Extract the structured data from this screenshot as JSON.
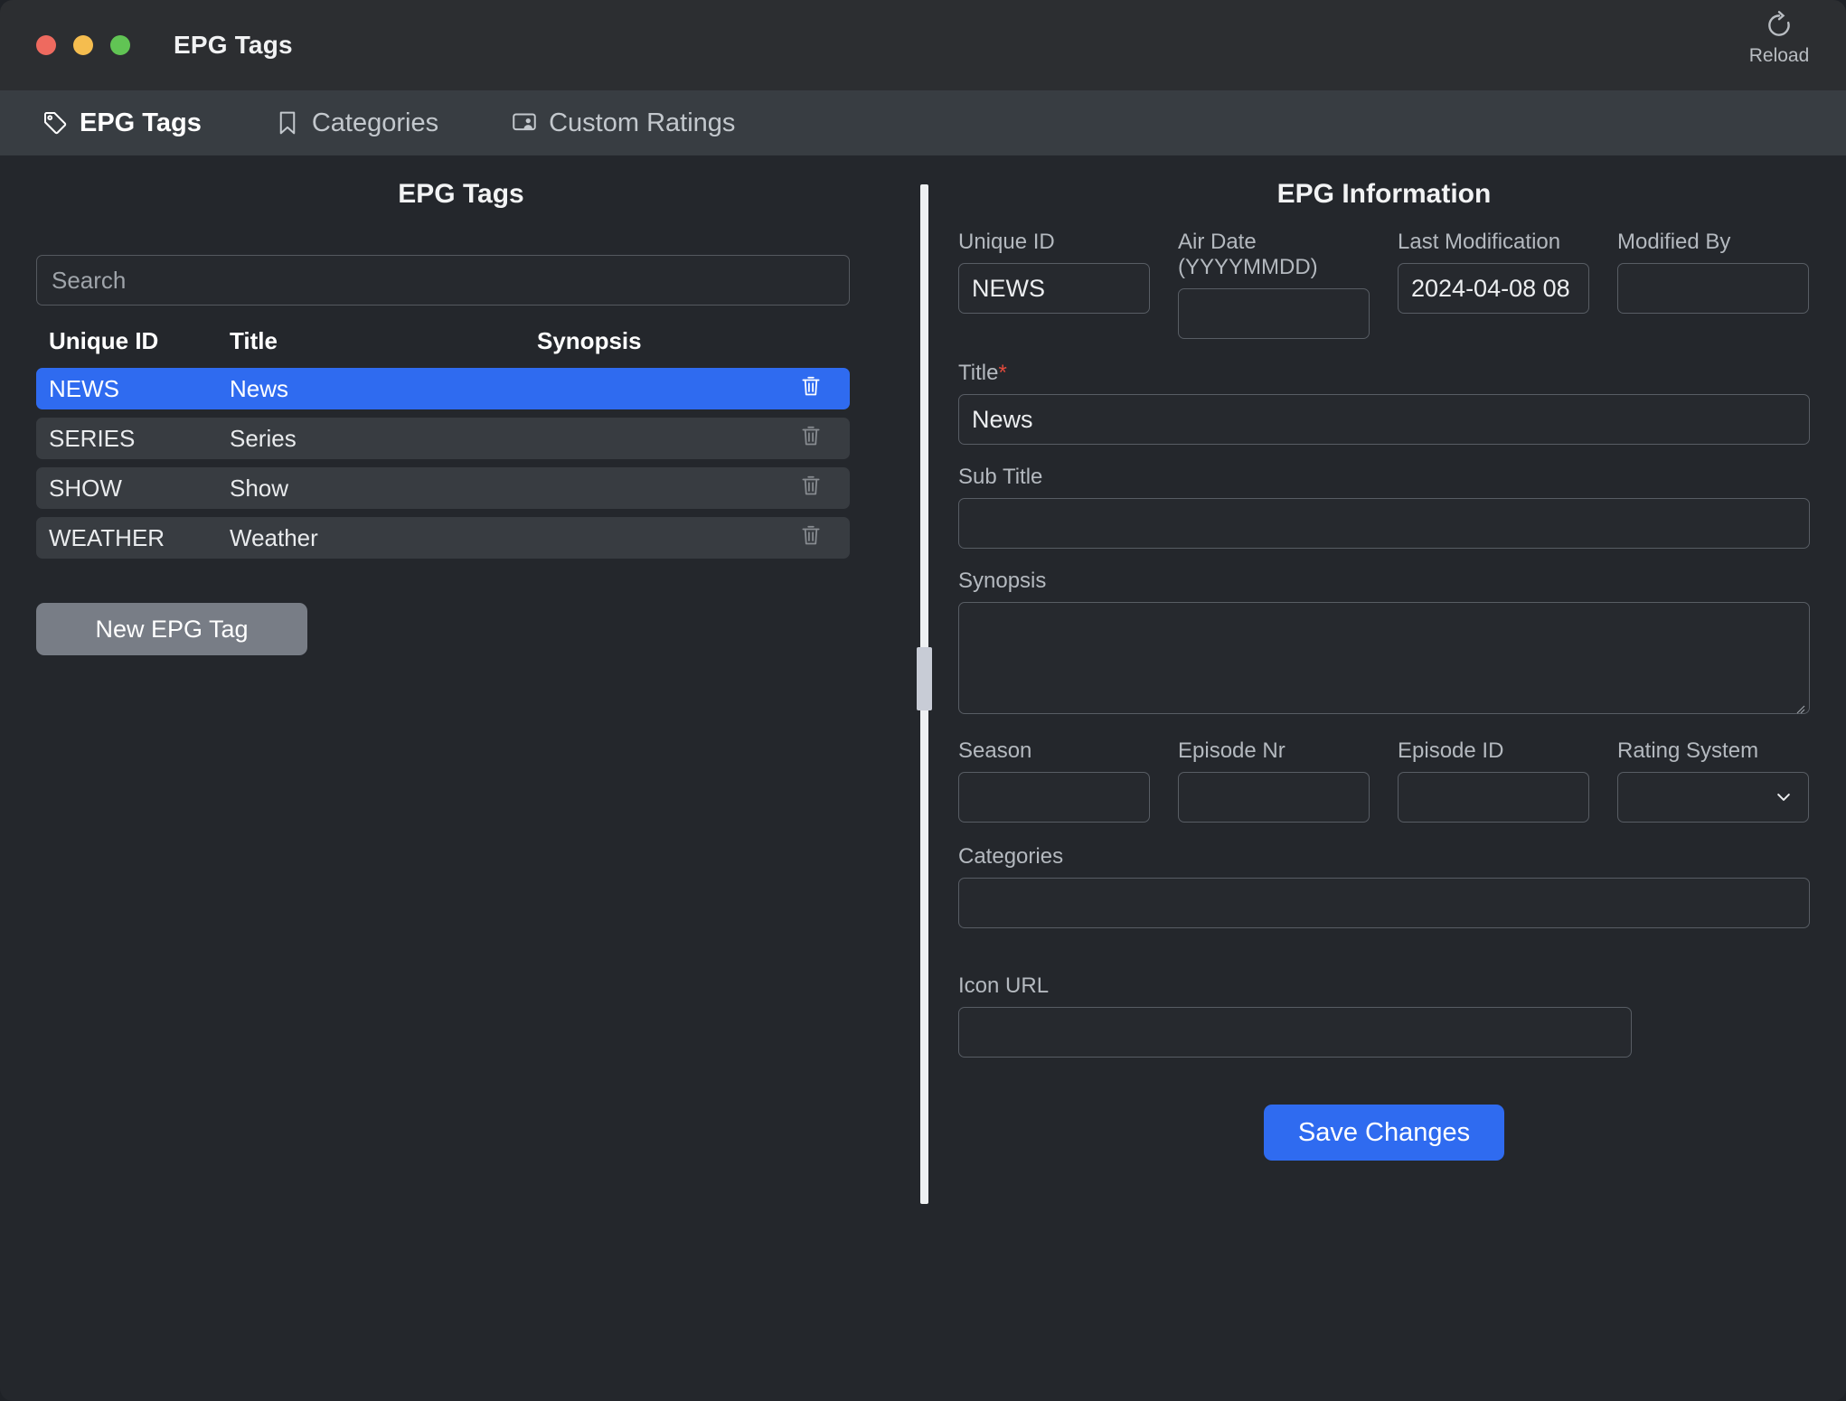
{
  "window": {
    "title": "EPG Tags",
    "traffic_lights": [
      "close",
      "minimize",
      "maximize"
    ],
    "reload_label": "Reload"
  },
  "tabs": [
    {
      "label": "EPG Tags",
      "icon": "tag-icon",
      "active": true
    },
    {
      "label": "Categories",
      "icon": "bookmark-icon",
      "active": false
    },
    {
      "label": "Custom Ratings",
      "icon": "screen-person-icon",
      "active": false
    }
  ],
  "left_panel": {
    "title": "EPG Tags",
    "search_placeholder": "Search",
    "search_value": "",
    "columns": [
      "Unique ID",
      "Title",
      "Synopsis"
    ],
    "rows": [
      {
        "unique_id": "NEWS",
        "title": "News",
        "synopsis": "",
        "selected": true
      },
      {
        "unique_id": "SERIES",
        "title": "Series",
        "synopsis": "",
        "selected": false
      },
      {
        "unique_id": "SHOW",
        "title": "Show",
        "synopsis": "",
        "selected": false
      },
      {
        "unique_id": "WEATHER",
        "title": "Weather",
        "synopsis": "",
        "selected": false
      }
    ],
    "new_tag_label": "New EPG Tag"
  },
  "right_panel": {
    "title": "EPG Information",
    "fields": {
      "unique_id": {
        "label": "Unique ID",
        "value": "NEWS"
      },
      "air_date": {
        "label": "Air Date (YYYYMMDD)",
        "value": ""
      },
      "last_modification": {
        "label": "Last Modification",
        "value": "2024-04-08 08"
      },
      "modified_by": {
        "label": "Modified By",
        "value": ""
      },
      "title": {
        "label": "Title",
        "required_marker": "*",
        "value": "News"
      },
      "sub_title": {
        "label": "Sub Title",
        "value": ""
      },
      "synopsis": {
        "label": "Synopsis",
        "value": ""
      },
      "season": {
        "label": "Season",
        "value": ""
      },
      "episode_nr": {
        "label": "Episode Nr",
        "value": ""
      },
      "episode_id": {
        "label": "Episode ID",
        "value": ""
      },
      "rating_system": {
        "label": "Rating System",
        "value": ""
      },
      "categories": {
        "label": "Categories",
        "value": ""
      },
      "icon_url": {
        "label": "Icon URL",
        "value": ""
      }
    },
    "save_label": "Save Changes"
  },
  "colors": {
    "accent": "#2f6bf0",
    "titlebar": "#2c2e31",
    "tabbar": "#383d42",
    "background": "#24272c",
    "row": "#383c41",
    "required": "#e34b3d",
    "neutral_button": "#787d86"
  }
}
